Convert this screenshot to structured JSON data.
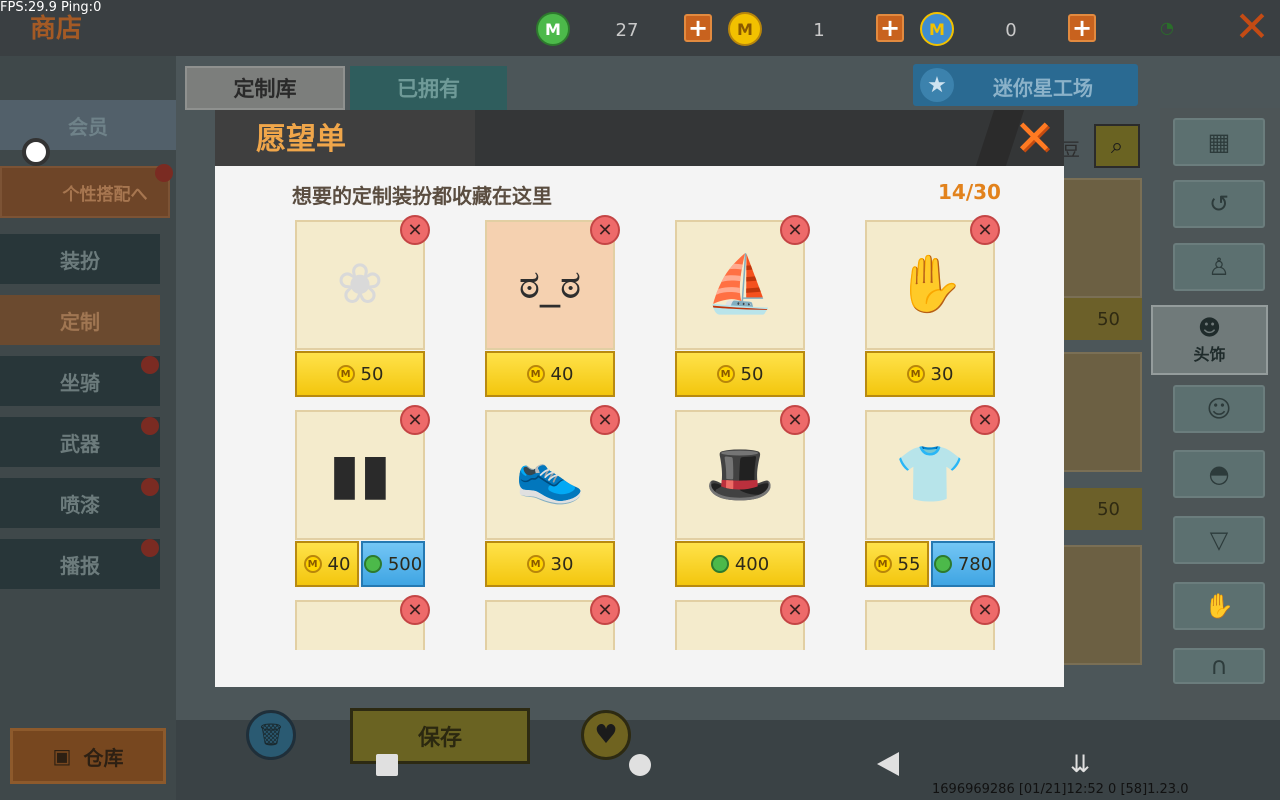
{
  "debug_overlay": "FPS:29.9  Ping:0",
  "header": {
    "shop_title": "商店",
    "currencies": [
      {
        "icon": "green-gem-icon",
        "value": "27",
        "color": "#4cb94a"
      },
      {
        "icon": "gold-coin-icon",
        "value": "1",
        "color": "#f2c100"
      },
      {
        "icon": "mini-star-coin-icon",
        "value": "0",
        "color": "#3f8dd0"
      }
    ]
  },
  "tabs": {
    "library": "定制库",
    "owned": "已拥有"
  },
  "workshop_label": "迷你星工场",
  "sidebar": {
    "member": "会员",
    "outfit_collocation": "个性搭配へ",
    "items": [
      {
        "label": "装扮",
        "badge": false
      },
      {
        "label": "定制",
        "badge": false
      },
      {
        "label": "坐骑",
        "badge": true
      },
      {
        "label": "武器",
        "badge": true
      },
      {
        "label": "喷漆",
        "badge": true
      },
      {
        "label": "播报",
        "badge": true
      }
    ],
    "warehouse": "仓库"
  },
  "right_panel": {
    "head_accessory": "头饰",
    "search_hint": "豆"
  },
  "background_prices": [
    "50",
    "50"
  ],
  "bottom": {
    "save": "保存"
  },
  "modal": {
    "title": "愿望单",
    "description": "想要的定制装扮都收藏在这里",
    "count": "14/30",
    "items": [
      {
        "name": "bunny-ear-white-hair",
        "prices": [
          {
            "currency": "coin",
            "value": "50"
          }
        ]
      },
      {
        "name": "grumpy-face",
        "prices": [
          {
            "currency": "coin",
            "value": "40"
          }
        ]
      },
      {
        "name": "sailor-shirt",
        "prices": [
          {
            "currency": "coin",
            "value": "50"
          }
        ]
      },
      {
        "name": "pink-paw-gloves",
        "prices": [
          {
            "currency": "coin",
            "value": "30"
          }
        ]
      },
      {
        "name": "ripped-black-shorts",
        "prices": [
          {
            "currency": "coin",
            "value": "40"
          },
          {
            "currency": "gem",
            "value": "500"
          }
        ]
      },
      {
        "name": "black-star-sneakers",
        "prices": [
          {
            "currency": "coin",
            "value": "30"
          }
        ]
      },
      {
        "name": "detective-hat-hair",
        "prices": [
          {
            "currency": "gem",
            "value": "400"
          }
        ]
      },
      {
        "name": "gray-school-sweater",
        "prices": [
          {
            "currency": "coin",
            "value": "55"
          },
          {
            "currency": "gem",
            "value": "780"
          }
        ]
      },
      {
        "name": "blue-item-partial",
        "prices": []
      },
      {
        "name": "dark-item-partial",
        "prices": []
      },
      {
        "name": "pink-paw-item-partial",
        "prices": []
      },
      {
        "name": "pink-item-partial",
        "prices": []
      }
    ]
  },
  "status_bar": "1696969286  [01/21]12:52 0   [58]1.23.0"
}
